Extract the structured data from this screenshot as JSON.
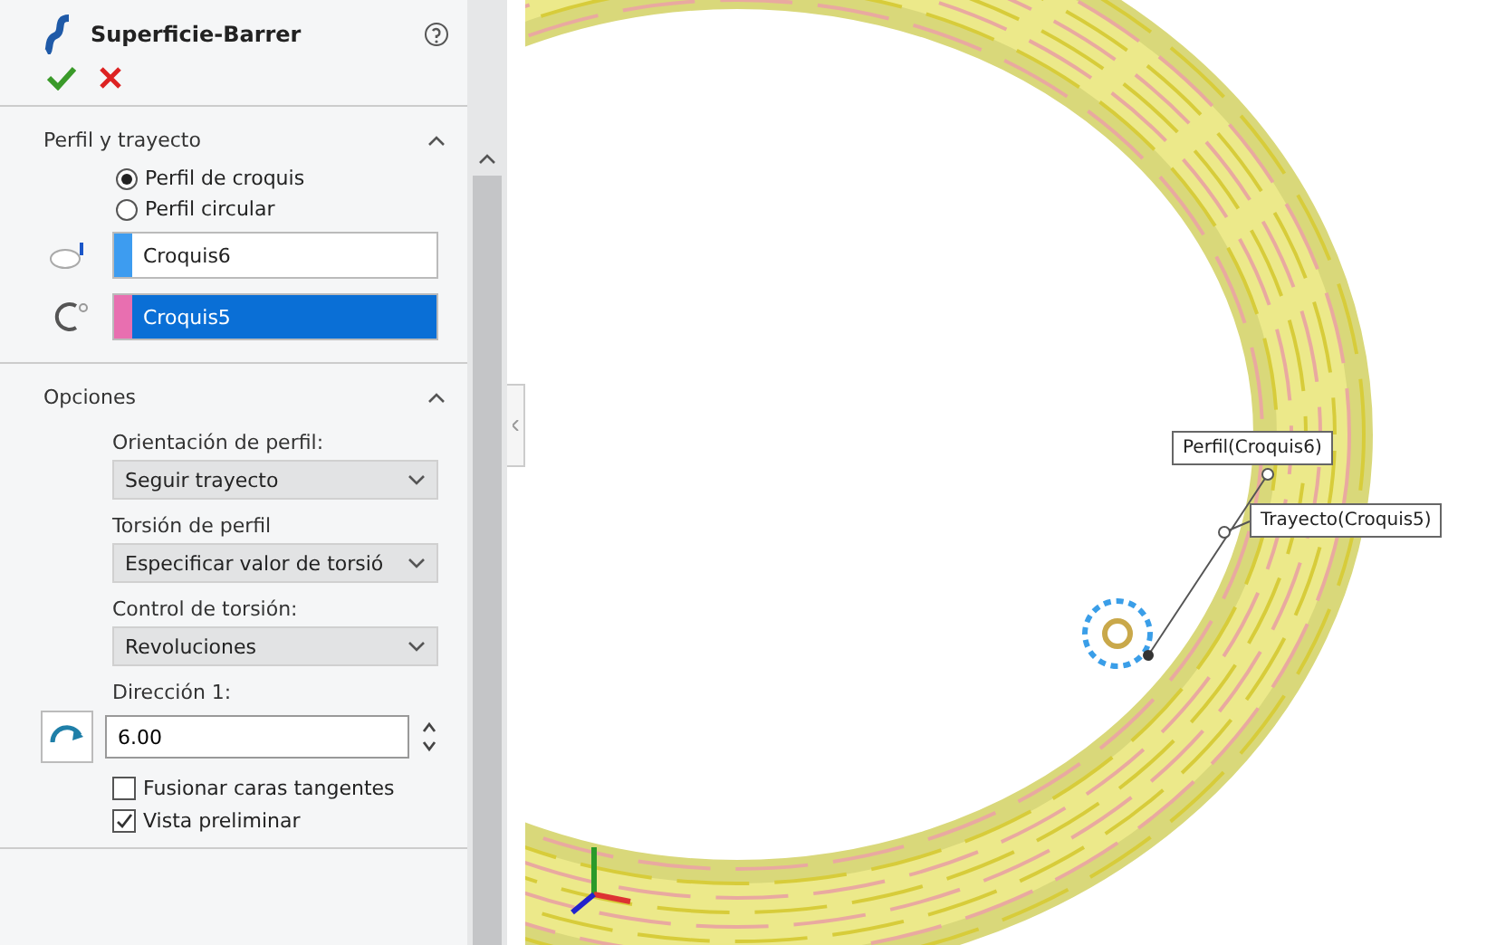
{
  "panel": {
    "title": "Superficie-Barrer",
    "sections": [
      {
        "title": "Perfil y trayecto",
        "expanded": true,
        "kind": "profile",
        "radios": [
          {
            "label": "Perfil de croquis",
            "selected": true
          },
          {
            "label": "Perfil circular",
            "selected": false
          }
        ],
        "selections": [
          {
            "value": "Croquis6",
            "color": "#3d9cf0",
            "highlighted": false,
            "kind": "profile"
          },
          {
            "value": "Croquis5",
            "color": "#e86fb0",
            "highlighted": true,
            "kind": "path"
          }
        ]
      },
      {
        "title": "Opciones",
        "expanded": true,
        "kind": "options",
        "dropdowns": [
          {
            "label": "Orientación de perfil:",
            "value": "Seguir trayecto"
          },
          {
            "label": "Torsión de perfil",
            "value": "Especificar valor de torsió"
          },
          {
            "label": "Control de torsión:",
            "value": "Revoluciones"
          }
        ],
        "spinner": {
          "label": "Dirección 1:",
          "value": "6.00"
        },
        "checkboxes": [
          {
            "label": "Fusionar caras tangentes",
            "checked": false
          },
          {
            "label": "Vista preliminar",
            "checked": true
          }
        ]
      }
    ]
  },
  "viewport": {
    "callouts": [
      {
        "label": "Perfil(Croquis6)"
      },
      {
        "label": "Trayecto(Croquis5)"
      }
    ]
  }
}
